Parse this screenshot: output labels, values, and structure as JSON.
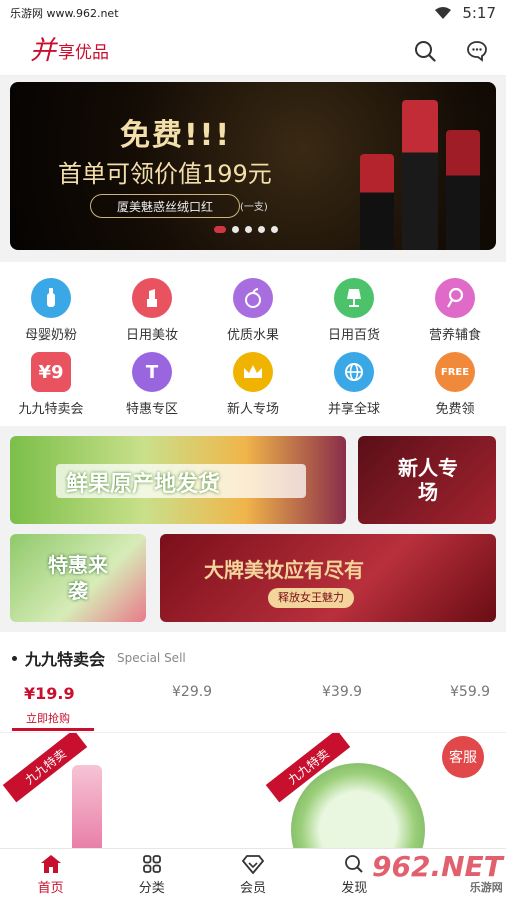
{
  "status_bar": {
    "site": "乐游网 www.962.net",
    "time": "5:17"
  },
  "header": {
    "logo_mark": "并",
    "logo_text": "享优品"
  },
  "banner": {
    "title": "免费!!!",
    "subtitle": "首单可领价值199元",
    "pill_label": "厦美魅惑丝绒口红",
    "pill_note": "(一支)",
    "slides": 5,
    "active_slide": 1
  },
  "categories": [
    {
      "label": "母婴奶粉",
      "icon": "baby-bottle-icon",
      "color": "#3aa7e6"
    },
    {
      "label": "日用美妆",
      "icon": "lipstick-icon",
      "color": "#e8535f"
    },
    {
      "label": "优质水果",
      "icon": "apple-icon",
      "color": "#a86ee0"
    },
    {
      "label": "日用百货",
      "icon": "lamp-icon",
      "color": "#4cc36a"
    },
    {
      "label": "营养辅食",
      "icon": "lollipop-icon",
      "color": "#e06ac8"
    },
    {
      "label": "九九特卖会",
      "icon": "price-tag-icon",
      "color": "#e8535f"
    },
    {
      "label": "特惠专区",
      "icon": "t-badge-icon",
      "color": "#9a66e0"
    },
    {
      "label": "新人专场",
      "icon": "crown-icon",
      "color": "#f0b400"
    },
    {
      "label": "并享全球",
      "icon": "globe-icon",
      "color": "#3aa7e6"
    },
    {
      "label": "免费领",
      "icon": "free-badge-icon",
      "color": "#f08a3a"
    }
  ],
  "promos": {
    "fruit": "鲜果原产地发货",
    "newcomer": "新人专场",
    "discount": "特惠来袭",
    "makeup": "大牌美妆应有尽有",
    "makeup_sub": "释放女王魅力"
  },
  "sale": {
    "title": "九九特卖会",
    "subtitle": "Special Sell",
    "tiers": [
      "¥19.9",
      "¥29.9",
      "¥39.9",
      "¥59.9"
    ],
    "active_tier": 0,
    "active_note": "立即抢购",
    "ribbon": "九九特卖"
  },
  "customer_service": "客服",
  "tabs": [
    {
      "label": "首页",
      "icon": "home-icon",
      "active": true
    },
    {
      "label": "分类",
      "icon": "grid-icon",
      "active": false
    },
    {
      "label": "会员",
      "icon": "diamond-icon",
      "active": false
    },
    {
      "label": "发现",
      "icon": "search-icon",
      "active": false
    }
  ],
  "watermark": {
    "brand": "962.NET",
    "sub": "乐游网"
  },
  "colors": {
    "brand_red": "#c8102e"
  }
}
